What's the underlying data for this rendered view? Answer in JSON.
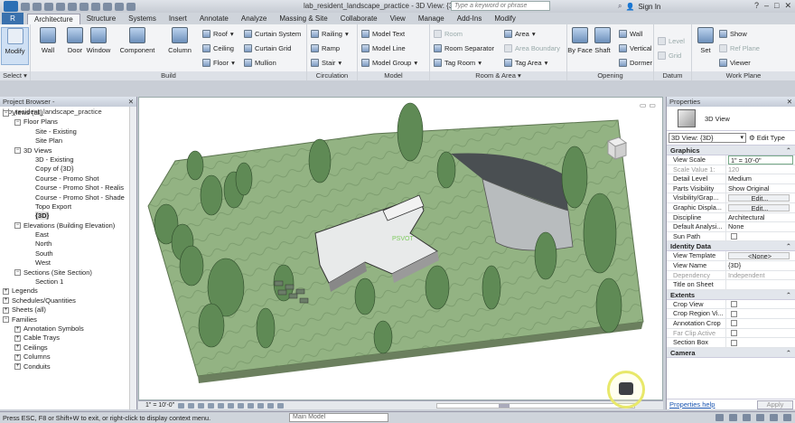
{
  "titlebar": {
    "title": "lab_resident_landscape_practice - 3D View: {3D}",
    "search_placeholder": "Type a keyword or phrase",
    "signin": "Sign In"
  },
  "tabs": [
    "Architecture",
    "Structure",
    "Systems",
    "Insert",
    "Annotate",
    "Analyze",
    "Massing & Site",
    "Collaborate",
    "View",
    "Manage",
    "Add-Ins",
    "Modify"
  ],
  "ribbon": {
    "select_label": "Select",
    "modify": "Modify",
    "build": {
      "title": "Build",
      "big": [
        "Wall",
        "Door",
        "Window",
        "Component",
        "Column"
      ],
      "small": [
        "Roof",
        "Ceiling",
        "Floor",
        "Curtain System",
        "Curtain Grid",
        "Mullion"
      ]
    },
    "circulation": {
      "title": "Circulation",
      "items": [
        "Railing",
        "Ramp",
        "Stair"
      ]
    },
    "model": {
      "title": "Model",
      "items": [
        "Model Text",
        "Model Line",
        "Model Group"
      ]
    },
    "room_area": {
      "title": "Room & Area",
      "items": [
        "Room",
        "Room Separator",
        "Tag Room",
        "Area",
        "Area Boundary",
        "Tag Area"
      ]
    },
    "opening": {
      "title": "Opening",
      "big": [
        "By Face",
        "Shaft"
      ],
      "items": [
        "Wall",
        "Vertical",
        "Dormer"
      ]
    },
    "datum": {
      "title": "Datum",
      "items": [
        "Level",
        "Grid"
      ]
    },
    "workplane": {
      "title": "Work Plane",
      "big": [
        "Set"
      ],
      "items": [
        "Show",
        "Ref Plane",
        "Viewer"
      ]
    }
  },
  "project_browser": {
    "title": "Project Browser - lab_resident_landscape_practice",
    "tree": [
      {
        "label": "Views (all)",
        "level": 0,
        "tog": "−"
      },
      {
        "label": "Floor Plans",
        "level": 1,
        "tog": "−"
      },
      {
        "label": "Site - Existing",
        "level": 2
      },
      {
        "label": "Site Plan",
        "level": 2
      },
      {
        "label": "3D Views",
        "level": 1,
        "tog": "−"
      },
      {
        "label": "3D - Existing",
        "level": 2
      },
      {
        "label": "Copy of {3D}",
        "level": 2
      },
      {
        "label": "Course - Promo Shot",
        "level": 2
      },
      {
        "label": "Course - Promo Shot - Realis",
        "level": 2
      },
      {
        "label": "Course - Promo Shot - Shade",
        "level": 2
      },
      {
        "label": "Topo Export",
        "level": 2
      },
      {
        "label": "{3D}",
        "level": 2,
        "selected": true
      },
      {
        "label": "Elevations (Building Elevation)",
        "level": 1,
        "tog": "−"
      },
      {
        "label": "East",
        "level": 2
      },
      {
        "label": "North",
        "level": 2
      },
      {
        "label": "South",
        "level": 2
      },
      {
        "label": "West",
        "level": 2
      },
      {
        "label": "Sections (Site Section)",
        "level": 1,
        "tog": "−"
      },
      {
        "label": "Section 1",
        "level": 2
      },
      {
        "label": "Legends",
        "level": 0,
        "tog": "+"
      },
      {
        "label": "Schedules/Quantities",
        "level": 0,
        "tog": "+"
      },
      {
        "label": "Sheets (all)",
        "level": 0,
        "tog": "+"
      },
      {
        "label": "Families",
        "level": 0,
        "tog": "−"
      },
      {
        "label": "Annotation Symbols",
        "level": 1,
        "tog": "+"
      },
      {
        "label": "Cable Trays",
        "level": 1,
        "tog": "+"
      },
      {
        "label": "Ceilings",
        "level": 1,
        "tog": "+"
      },
      {
        "label": "Columns",
        "level": 1,
        "tog": "+"
      },
      {
        "label": "Conduits",
        "level": 1,
        "tog": "+"
      }
    ]
  },
  "canvas": {
    "model_label": "PSVOT"
  },
  "viewbar": {
    "scale": "1\" = 10'-0\""
  },
  "properties": {
    "title": "Properties",
    "type_name": "3D View",
    "instance_selector": "3D View: {3D}",
    "edit_type": "Edit Type",
    "sections": [
      {
        "name": "Graphics",
        "rows": [
          {
            "k": "View Scale",
            "v": "1\" = 10'-0\"",
            "style": "input"
          },
          {
            "k": "Scale Value  1:",
            "v": "120",
            "style": "ro"
          },
          {
            "k": "Detail Level",
            "v": "Medium"
          },
          {
            "k": "Parts Visibility",
            "v": "Show Original"
          },
          {
            "k": "Visibility/Grap...",
            "v": "Edit...",
            "style": "btn"
          },
          {
            "k": "Graphic Displa...",
            "v": "Edit...",
            "style": "btn"
          },
          {
            "k": "Discipline",
            "v": "Architectural"
          },
          {
            "k": "Default Analysi...",
            "v": "None"
          },
          {
            "k": "Sun Path",
            "v": "",
            "chk": true
          }
        ]
      },
      {
        "name": "Identity Data",
        "rows": [
          {
            "k": "View Template",
            "v": "<None>",
            "style": "btn"
          },
          {
            "k": "View Name",
            "v": "{3D}"
          },
          {
            "k": "Dependency",
            "v": "Independent",
            "style": "ro"
          },
          {
            "k": "Title on Sheet",
            "v": ""
          }
        ]
      },
      {
        "name": "Extents",
        "rows": [
          {
            "k": "Crop View",
            "v": "",
            "chk": true
          },
          {
            "k": "Crop Region Vi...",
            "v": "",
            "chk": true
          },
          {
            "k": "Annotation Crop",
            "v": "",
            "chk": true
          },
          {
            "k": "Far Clip Active",
            "v": "",
            "chk": true,
            "style": "ro"
          },
          {
            "k": "Section Box",
            "v": "",
            "chk": true
          }
        ]
      },
      {
        "name": "Camera",
        "rows": []
      }
    ],
    "help_link": "Properties help",
    "apply": "Apply"
  },
  "statusbar": {
    "text": "Press ESC, F8 or Shift+W to exit, or right-click to display context menu.",
    "workset": "Main Model"
  },
  "colors": {
    "accent": "#3a71ad",
    "terrain": "#8fae7d",
    "trees": "#5f8a55"
  }
}
